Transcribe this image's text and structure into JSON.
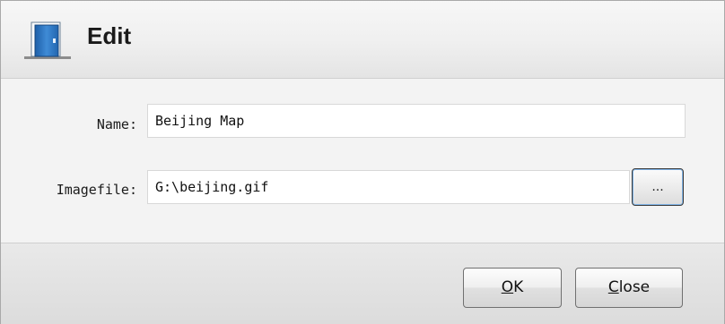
{
  "dialog": {
    "title": "Edit",
    "icon": "door-icon"
  },
  "form": {
    "name_label": "Name:",
    "name_value": "Beijing Map",
    "imagefile_label": "Imagefile:",
    "imagefile_value": "G:\\beijing.gif",
    "browse_label": "..."
  },
  "footer": {
    "ok_mnemonic": "O",
    "ok_rest": "K",
    "close_mnemonic": "C",
    "close_rest": "lose"
  }
}
